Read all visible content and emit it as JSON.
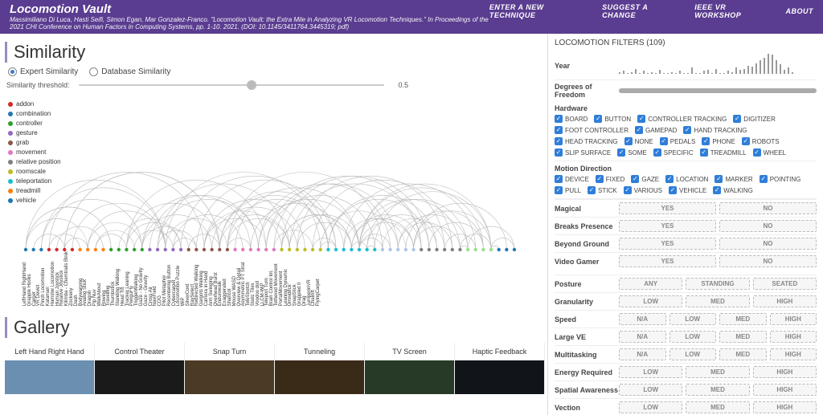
{
  "header": {
    "title": "Locomotion Vault",
    "citation": "Massimiliano Di Luca, Hasti Seifi, Simon Egan, Mar Gonzalez-Franco. \"Locomotion Vault: the Extra Mile in Analyzing VR Locomotion Techniques.\" In Proceedings of the 2021 CHI Conference on Human Factors in Computing Systems, pp. 1-10. 2021. (DOI: 10.1145/3411764.3445319; pdf)",
    "nav": [
      "ENTER A NEW TECHNIQUE",
      "SUGGEST A CHANGE",
      "IEEE VR WORKSHOP",
      "ABOUT"
    ]
  },
  "similarity": {
    "heading": "Similarity",
    "modes": {
      "expert": "Expert Similarity",
      "database": "Database Similarity",
      "selected": "expert"
    },
    "threshold_label": "Similarity threshold:",
    "threshold_value": "0.5",
    "legend": [
      {
        "label": "addon",
        "color": "#d62728"
      },
      {
        "label": "combination",
        "color": "#1f77b4"
      },
      {
        "label": "controller",
        "color": "#2ca02c"
      },
      {
        "label": "gesture",
        "color": "#9467bd"
      },
      {
        "label": "grab",
        "color": "#8c564b"
      },
      {
        "label": "movement",
        "color": "#e377c2"
      },
      {
        "label": "relative position",
        "color": "#7f7f7f"
      },
      {
        "label": "roomscale",
        "color": "#bcbd22"
      },
      {
        "label": "teleportation",
        "color": "#17becf"
      },
      {
        "label": "treadmill",
        "color": "#ff7f0e"
      },
      {
        "label": "vehicle",
        "color": "#1f77b4"
      }
    ],
    "nodes": [
      "LeftHand RightHand",
      "Grapple Hooks",
      "Carpet",
      "VR Devkit",
      "Pinch Locomotion",
      "Katamari",
      "Hamster Locomotion",
      "Human Joystick",
      "Relative Joystick",
      "Kilimba - Chemtrails Blnik",
      "Zockeny",
      "Dash",
      "Bodywarping",
      "Analog Stick",
      "Dragon",
      "Pip Nuv",
      "WalkAbout",
      "Rowing",
      "Travelling",
      "Thumbstick",
      "Standing Walking",
      "Head Tilt",
      "Tracker Leaning",
      "PenguFly",
      "TriggerWalking",
      "Gaze - No Gravity",
      "Gaze - Gravity",
      "Cross Air",
      "NaviField",
      "CDG",
      "Pilot Metaphor",
      "Recentering Button",
      "Cybercarpet",
      "Locomotion Puzzle",
      "WiP",
      "SilverCord",
      "RaySelect",
      "Redirected Walking",
      "Gargots Walking",
      "Camera in Hand",
      "Arm Swinging",
      "Overhead Burst",
      "Endurowalk",
      "Exaggerated",
      "Sharicot",
      "Mouse WASD",
      "Overview & Detail",
      "Asymmetric PT Strat",
      "TeleStretch",
      "Static Tiles",
      "Voodoo doll",
      "LLCM-WiP",
      "Teleport Turn",
      "Brain Control Int.",
      "Tethered Movement",
      "PortalMovement",
      "Leaning Dynamic",
      "Omnideck",
      "SnapStick",
      "Grappled II",
      "Drag",
      "JumperinVR",
      "Chairlift",
      "FlyingCarpet"
    ],
    "node_colors": [
      "#1f77b4",
      "#1f77b4",
      "#1f77b4",
      "#d62728",
      "#d62728",
      "#d62728",
      "#d62728",
      "#ff7f0e",
      "#ff7f0e",
      "#ff7f0e",
      "#ff7f0e",
      "#2ca02c",
      "#2ca02c",
      "#2ca02c",
      "#2ca02c",
      "#2ca02c",
      "#9467bd",
      "#9467bd",
      "#9467bd",
      "#9467bd",
      "#9467bd",
      "#8c564b",
      "#8c564b",
      "#8c564b",
      "#8c564b",
      "#8c564b",
      "#8c564b",
      "#e377c2",
      "#e377c2",
      "#e377c2",
      "#e377c2",
      "#e377c2",
      "#e377c2",
      "#bcbd22",
      "#bcbd22",
      "#bcbd22",
      "#bcbd22",
      "#bcbd22",
      "#bcbd22",
      "#17becf",
      "#17becf",
      "#17becf",
      "#17becf",
      "#17becf",
      "#17becf",
      "#17becf",
      "#aec7e8",
      "#aec7e8",
      "#aec7e8",
      "#aec7e8",
      "#aec7e8",
      "#7f7f7f",
      "#7f7f7f",
      "#7f7f7f",
      "#7f7f7f",
      "#7f7f7f",
      "#7f7f7f",
      "#98df8a",
      "#98df8a",
      "#98df8a",
      "#98df8a",
      "#1f77b4",
      "#1f77b4",
      "#1f77b4"
    ]
  },
  "gallery": {
    "heading": "Gallery",
    "items": [
      {
        "title": "Left Hand Right Hand",
        "bg": "#6a8fb1"
      },
      {
        "title": "Control Theater",
        "bg": "#1a1a1a"
      },
      {
        "title": "Snap Turn",
        "bg": "#4b3a24"
      },
      {
        "title": "Tunneling",
        "bg": "#3a2a18"
      },
      {
        "title": "TV Screen",
        "bg": "#273a27"
      },
      {
        "title": "Haptic Feedback",
        "bg": "#111418"
      }
    ]
  },
  "filters": {
    "title": "LOCOMOTION FILTERS (109)",
    "year": {
      "label": "Year",
      "bars": [
        1,
        2,
        0,
        1,
        4,
        0,
        2,
        0,
        1,
        0,
        3,
        0,
        0,
        1,
        0,
        2,
        0,
        0,
        5,
        0,
        0,
        2,
        3,
        0,
        4,
        0,
        0,
        2,
        1,
        5,
        3,
        4,
        7,
        6,
        9,
        12,
        14,
        18,
        17,
        12,
        8,
        3,
        5,
        1
      ]
    },
    "dof": {
      "label": "Degrees of Freedom"
    },
    "hardware": {
      "label": "Hardware",
      "items": [
        "BOARD",
        "BUTTON",
        "CONTROLLER TRACKING",
        "DIGITIZER",
        "FOOT CONTROLLER",
        "GAMEPAD",
        "HAND TRACKING",
        "HEAD TRACKING",
        "NONE",
        "PEDALS",
        "PHONE",
        "ROBOTS",
        "SLIP SURFACE",
        "SOME",
        "SPECIFIC",
        "TREADMILL",
        "WHEEL"
      ]
    },
    "motion": {
      "label": "Motion Direction",
      "items": [
        "DEVICE",
        "FIXED",
        "GAZE",
        "LOCATION",
        "MARKER",
        "POINTING",
        "PULL",
        "STICK",
        "VARIOUS",
        "VEHICLE",
        "WALKING"
      ]
    },
    "binary": [
      {
        "label": "Magical",
        "opts": [
          "YES",
          "NO"
        ]
      },
      {
        "label": "Breaks Presence",
        "opts": [
          "YES",
          "NO"
        ]
      },
      {
        "label": "Beyond Ground",
        "opts": [
          "YES",
          "NO"
        ]
      },
      {
        "label": "Video Gamer",
        "opts": [
          "YES",
          "NO"
        ]
      }
    ],
    "scales": [
      {
        "label": "Posture",
        "opts": [
          "ANY",
          "STANDING",
          "SEATED"
        ]
      },
      {
        "label": "Granularity",
        "opts": [
          "LOW",
          "MED",
          "HIGH"
        ]
      },
      {
        "label": "Speed",
        "opts": [
          "N/A",
          "LOW",
          "MED",
          "HIGH"
        ]
      },
      {
        "label": "Large VE",
        "opts": [
          "N/A",
          "LOW",
          "MED",
          "HIGH"
        ]
      },
      {
        "label": "Multitasking",
        "opts": [
          "N/A",
          "LOW",
          "MED",
          "HIGH"
        ]
      },
      {
        "label": "Energy Required",
        "opts": [
          "LOW",
          "MED",
          "HIGH"
        ]
      },
      {
        "label": "Spatial Awareness",
        "opts": [
          "LOW",
          "MED",
          "HIGH"
        ]
      },
      {
        "label": "Vection",
        "opts": [
          "LOW",
          "MED",
          "HIGH"
        ]
      }
    ]
  },
  "chart_data": {
    "type": "arc-diagram",
    "note": "Node positions along x-axis; arcs connect similar techniques above threshold 0.5. Exact pairs not readable; ~80 arcs drawn between adjacent clusters.",
    "title": "Similarity",
    "threshold": 0.5
  }
}
